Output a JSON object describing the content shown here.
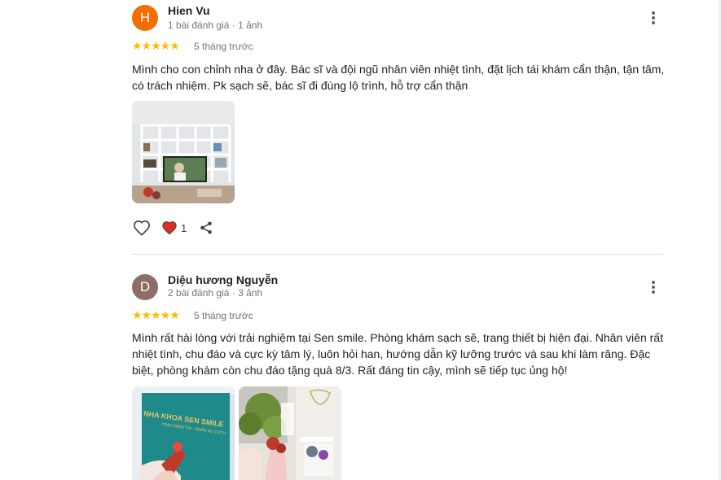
{
  "reviews": [
    {
      "avatar_letter": "H",
      "avatar_color": "#f46d01",
      "name": "Hien Vu",
      "meta": "1 bài đánh giá · 1 ảnh",
      "stars": "★★★★★",
      "ago": "5 tháng trước",
      "text": "Mình cho con chỉnh nha ở đây. Bác sĩ và đội ngũ nhân viên nhiệt tình, đặt lịch tái khám cẩn thận, tận tâm, có trách nhiệm. Pk sạch sẽ, bác sĩ đi đúng lộ trình, hỗ trợ cẩn thận",
      "like_count": "1"
    },
    {
      "avatar_letter": "D",
      "avatar_color": "#8d6e63",
      "name": "Diệu hương Nguyễn",
      "meta": "2 bài đánh giá · 3 ảnh",
      "stars": "★★★★★",
      "ago": "5 tháng trước",
      "text": "Mình rất hài lòng với trải nghiệm tại Sen smile. Phòng khám sạch sẽ, trang thiết bị hiện đại. Nhân viên rất nhiệt tình, chu đáo và cực kỳ tâm lý, luôn hỏi han, hướng dẫn kỹ lưỡng trước và sau khi làm răng. Đặc biệt, phòng khám còn chu đáo tặng quà 8/3. Rất đáng tin cậy, mình sẽ tiếp tục ủng hộ!"
    }
  ],
  "colors": {
    "star": "#fbbc04",
    "heart_red": "#d93025",
    "muted": "#70757a"
  },
  "photo_signs": {
    "clinic_sign": "NHA KHOA SEN SMILE",
    "clinic_slogan": "TRAO NIỀM TIN · NHẬN NỤ CƯỜI"
  }
}
